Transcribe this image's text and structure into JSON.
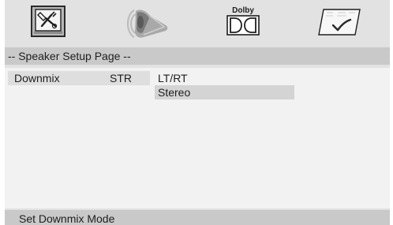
{
  "tabs": [
    {
      "name": "general-setup",
      "icon": "tools-screen-icon",
      "caption": ""
    },
    {
      "name": "speaker-setup",
      "icon": "speaker-icon",
      "caption": ""
    },
    {
      "name": "dolby-setup",
      "icon": "dolby-icon",
      "caption": "Dolby"
    },
    {
      "name": "preference",
      "icon": "checkmark-icon",
      "caption": ""
    }
  ],
  "page": {
    "title": "-- Speaker Setup Page --"
  },
  "settings": [
    {
      "label": "Downmix",
      "value": "STR"
    }
  ],
  "options": [
    {
      "label": "LT/RT",
      "selected": false
    },
    {
      "label": "Stereo",
      "selected": true
    }
  ],
  "status": {
    "text": "Set Downmix Mode"
  },
  "colors": {
    "background": "#e2e2e2",
    "header": "#c9c9c9",
    "content": "#f2f2f2",
    "highlight": "#d4d4d4",
    "text": "#1e1e1e"
  }
}
